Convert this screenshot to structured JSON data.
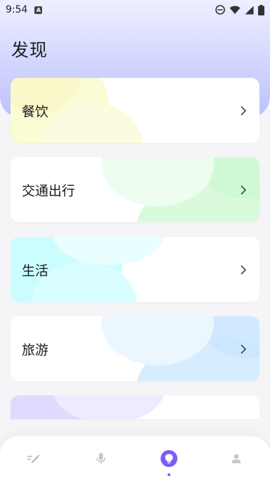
{
  "status_bar": {
    "time": "9:54",
    "badge": "A"
  },
  "page": {
    "title": "发现"
  },
  "cards": [
    {
      "label": "餐饮",
      "accent": "#fbfbd4"
    },
    {
      "label": "交通出行",
      "accent": "#d5fad9"
    },
    {
      "label": "生活",
      "accent": "#cafdff"
    },
    {
      "label": "旅游",
      "accent": "#d4ecff"
    },
    {
      "label": "",
      "accent": "#dcd9ff"
    }
  ],
  "bottom_nav": {
    "items": [
      "note-edit-icon",
      "microphone-icon",
      "lightbulb-icon",
      "person-icon"
    ],
    "active_index": 2,
    "active_color": "#7b5cf5"
  }
}
